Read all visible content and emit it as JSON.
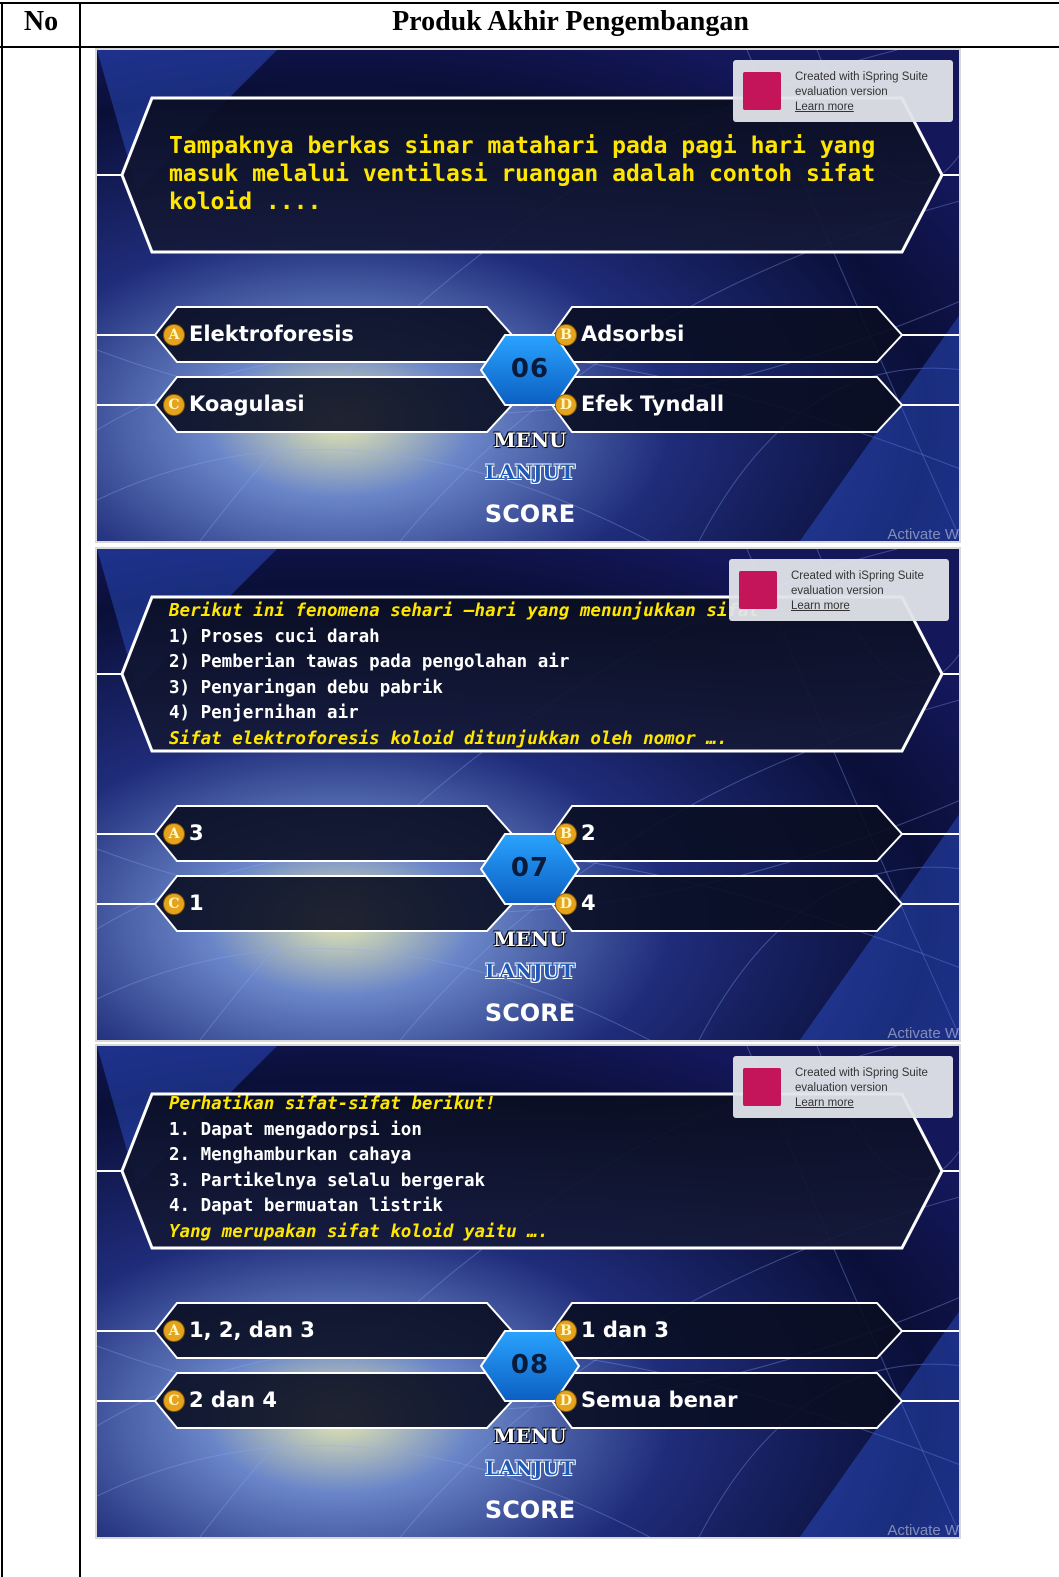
{
  "table": {
    "col_no": "No",
    "col_product": "Produk Akhir Pengembangan"
  },
  "slides": [
    {
      "question": "Tampaknya berkas sinar matahari pada pagi hari yang masuk melalui ventilasi ruangan adalah contoh sifat koloid ....",
      "number": "06",
      "answers": [
        {
          "letter": "A",
          "text": "Elektroforesis"
        },
        {
          "letter": "B",
          "text": "Adsorbsi"
        },
        {
          "letter": "C",
          "text": "Koagulasi"
        },
        {
          "letter": "D",
          "text": "Efek Tyndall"
        }
      ]
    },
    {
      "intro": "Berikut ini fenomena sehari –hari yang  menunjukkan sifat",
      "items": [
        "1)  Proses cuci darah",
        "2)  Pemberian tawas pada pengolahan air",
        "3)  Penyaringan debu pabrik",
        "4)  Penjernihan air"
      ],
      "outro": "Sifat elektroforesis koloid ditunjukkan oleh  nomor ….",
      "number": "07",
      "answers": [
        {
          "letter": "A",
          "text": "3"
        },
        {
          "letter": "B",
          "text": "2"
        },
        {
          "letter": "C",
          "text": "1"
        },
        {
          "letter": "D",
          "text": "4"
        }
      ]
    },
    {
      "intro": "Perhatikan sifat-sifat berikut!",
      "items": [
        "1. Dapat mengadorpsi ion",
        "2. Menghamburkan cahaya",
        "3. Partikelnya selalu bergerak",
        "4. Dapat bermuatan listrik"
      ],
      "outro": "Yang merupakan sifat koloid yaitu ….",
      "number": "08",
      "answers": [
        {
          "letter": "A",
          "text": "1, 2, dan 3"
        },
        {
          "letter": "B",
          "text": "1 dan 3"
        },
        {
          "letter": "C",
          "text": "2 dan 4"
        },
        {
          "letter": "D",
          "text": "Semua benar"
        }
      ]
    }
  ],
  "buttons": {
    "menu": "MENU",
    "lanjut": "LANJUT",
    "score": "SCORE"
  },
  "ispring": {
    "line1": "Created with iSpring Suite",
    "line2": "evaluation version",
    "learn_more": "Learn more"
  },
  "watermark": "Activate W",
  "colors": {
    "question_text": "#ffe600",
    "badge": "#e6a41e",
    "ispring_logo": "#c4155a",
    "hex_number": "#1d8de8"
  }
}
